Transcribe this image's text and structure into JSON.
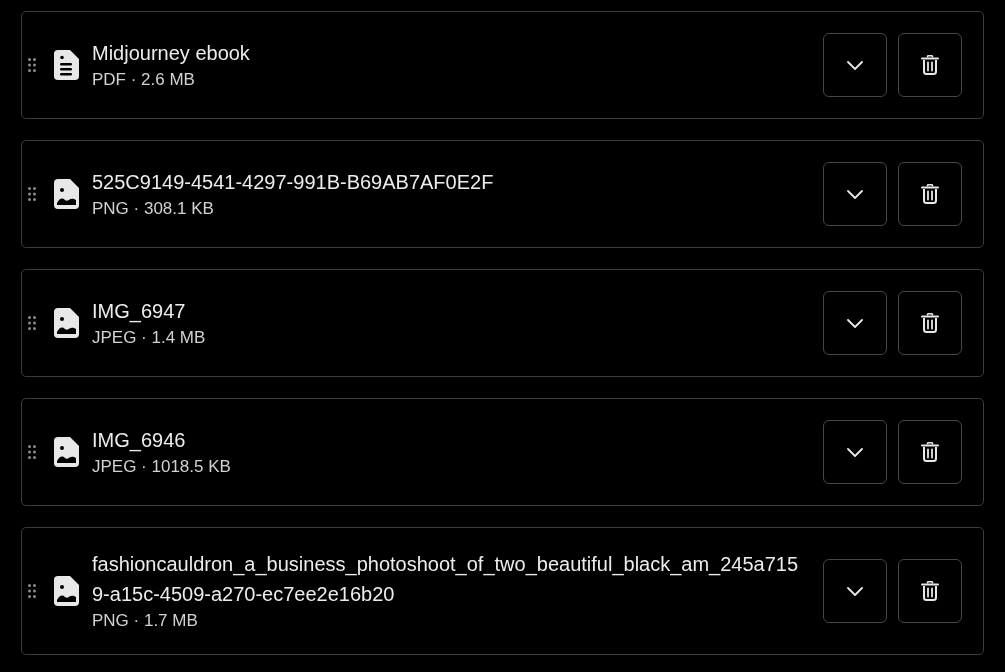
{
  "files": [
    {
      "kind": "document",
      "name": "Midjourney ebook",
      "meta": "PDF · 2.6 MB"
    },
    {
      "kind": "image",
      "name": "525C9149-4541-4297-991B-B69AB7AF0E2F",
      "meta": "PNG · 308.1 KB"
    },
    {
      "kind": "image",
      "name": "IMG_6947",
      "meta": "JPEG · 1.4 MB"
    },
    {
      "kind": "image",
      "name": "IMG_6946",
      "meta": "JPEG · 1018.5 KB"
    },
    {
      "kind": "image",
      "name": "fashioncauldron_a_business_photoshoot_of_two_beautiful_black_am_245a7159-a15c-4509-a270-ec7ee2e16b20",
      "meta": "PNG · 1.7 MB"
    }
  ]
}
